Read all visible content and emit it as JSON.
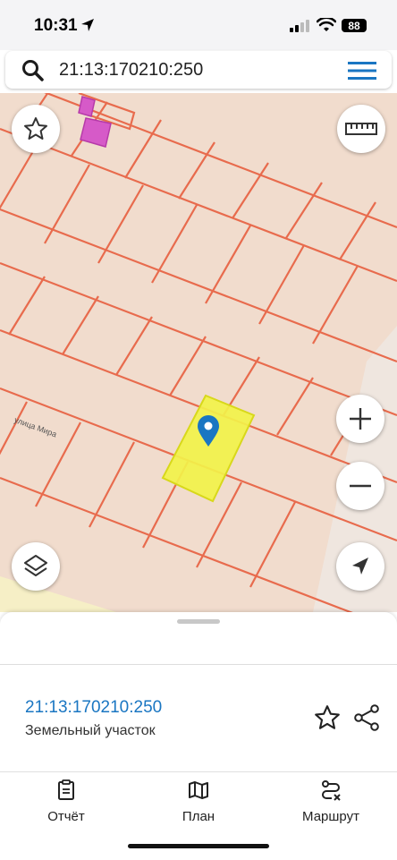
{
  "status": {
    "time": "10:31",
    "battery": "88"
  },
  "search": {
    "query": "21:13:170210:250"
  },
  "map": {
    "street_label": "улица Мира"
  },
  "colors": {
    "accent": "#1a76c2",
    "parcel_line": "#e86b4d",
    "selected_fill": "#f2f24a",
    "map_bg": "#f1dccd"
  },
  "card": {
    "cadastral_number": "21:13:170210:250",
    "type": "Земельный участок"
  },
  "tabs": [
    {
      "label": "Отчёт",
      "icon": "report-icon"
    },
    {
      "label": "План",
      "icon": "map-plan-icon"
    },
    {
      "label": "Маршрут",
      "icon": "route-icon"
    }
  ]
}
